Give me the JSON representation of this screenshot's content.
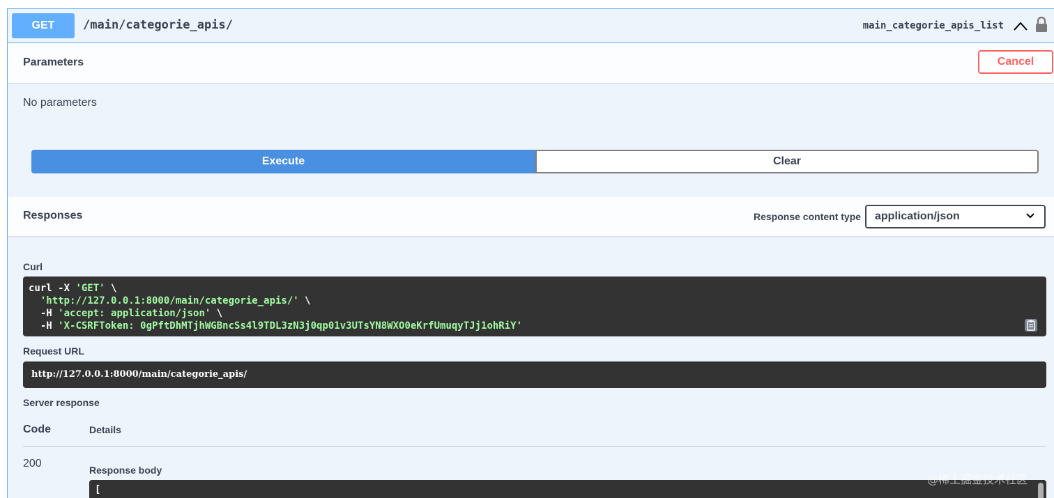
{
  "summary": {
    "method": "GET",
    "path": "/main/categorie_apis/",
    "operation_id": "main_categorie_apis_list",
    "collapse_icon": "chevron-up-icon",
    "lock_icon": "lock-icon"
  },
  "parameters": {
    "title": "Parameters",
    "cancel_label": "Cancel",
    "empty_text": "No parameters"
  },
  "actions": {
    "execute_label": "Execute",
    "clear_label": "Clear"
  },
  "responses": {
    "title": "Responses",
    "content_type_label": "Response content type",
    "content_type_value": "application/json",
    "content_type_options": [
      "application/json"
    ]
  },
  "curl": {
    "label": "Curl",
    "line1_prefix": "curl -X ",
    "line1_method": "'GET'",
    "line1_suffix": " \\",
    "line2_indent": "  ",
    "line2_url": "'http://127.0.0.1:8000/main/categorie_apis/'",
    "line2_suffix": " \\",
    "line3_prefix": "  -H ",
    "line3_header": "'accept: application/json'",
    "line3_suffix": " \\",
    "line4_prefix": "  -H ",
    "line4_header": "'X-CSRFToken: 0gPftDhMTjhWGBncSs4l9TDL3zN3j0qp01v3UTsYN8WXO0eKrfUmuqyTJj1ohRiY'",
    "copy_icon": "clipboard-icon"
  },
  "request_url": {
    "label": "Request URL",
    "value": "http://127.0.0.1:8000/main/categorie_apis/"
  },
  "server_response": {
    "label": "Server response",
    "code_header": "Code",
    "details_header": "Details",
    "code": "200",
    "body_label": "Response body",
    "body_first_line": "["
  },
  "watermark": "@稀土掘金技术社区",
  "colors": {
    "get_accent": "#61affe",
    "execute": "#4990e2",
    "cancel": "#ff6060",
    "code_bg": "#333333",
    "string": "#a2fca2"
  }
}
